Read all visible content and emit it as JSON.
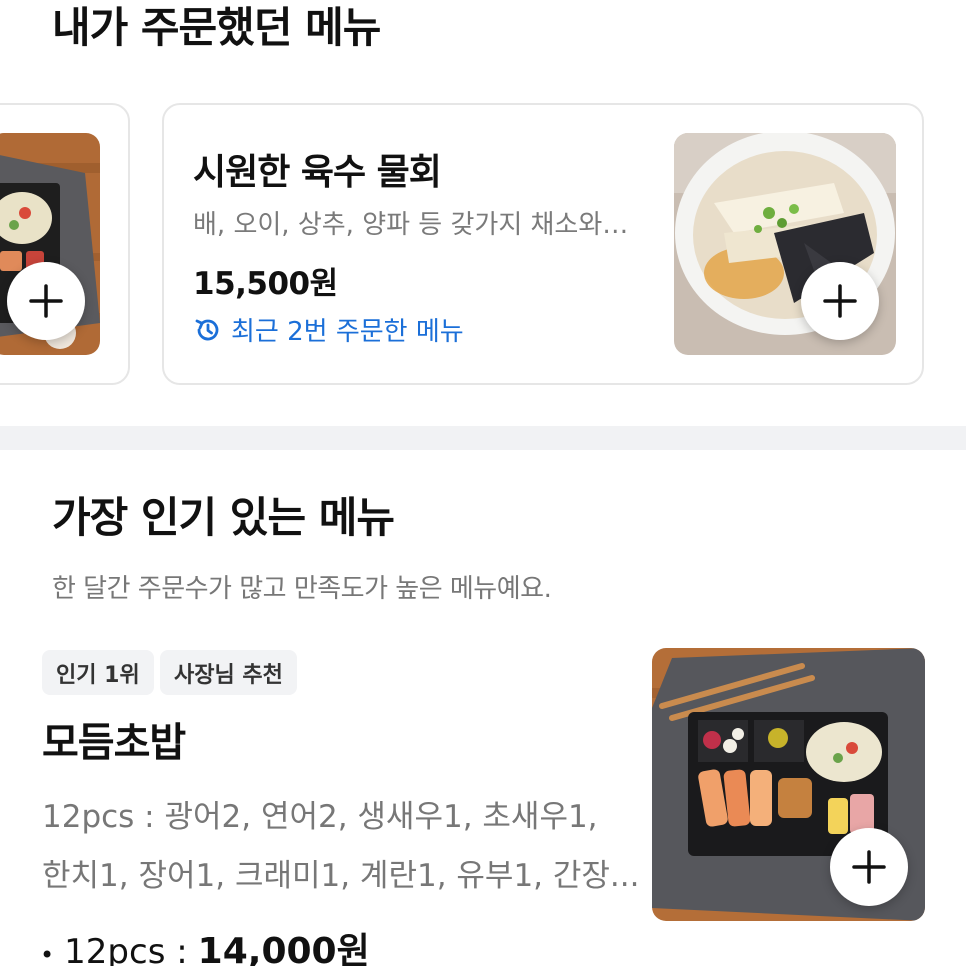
{
  "recent_section": {
    "title": "내가 주문했던 메뉴",
    "featured_item": {
      "name": "시원한 육수 물회",
      "description": "배, 오이, 상추, 양파 등 갖가지 채소와 ...",
      "price": "15,500원",
      "reorder_label": "최근 2번 주문한 메뉴"
    }
  },
  "popular_section": {
    "title": "가장 인기 있는 메뉴",
    "subtitle": "한 달간 주문수가 많고 만족도가 높은 메뉴예요.",
    "item": {
      "badges": [
        "인기 1위",
        "사장님 추천"
      ],
      "name": "모듬초밥",
      "description_lines": [
        "12pcs : 광어2, 연어2, 생새우1, 초새우1,",
        "한치1, 장어1, 크래미1, 계란1, 유부1, 간장..."
      ],
      "option_label": "12pcs :",
      "price": "14,000원"
    }
  },
  "colors": {
    "accent_blue": "#1b6fd8",
    "divider": "#f1f2f4",
    "badge_bg": "#f2f3f5"
  }
}
